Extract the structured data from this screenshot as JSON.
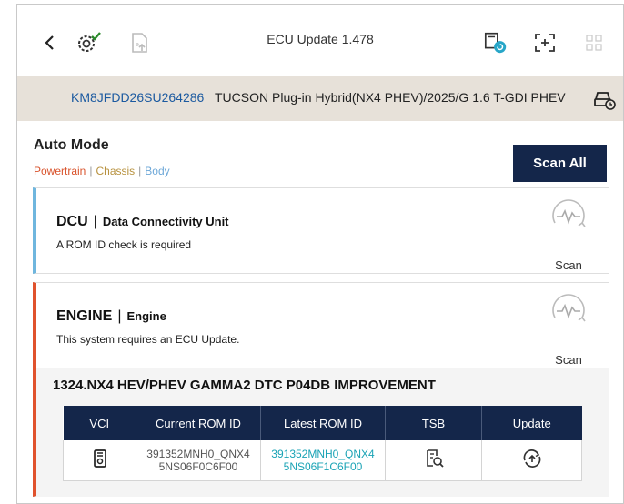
{
  "topbar": {
    "title": "ECU Update 1.478"
  },
  "vehicle": {
    "vin": "KM8JFDD26SU264286",
    "description": "TUCSON Plug-in Hybrid(NX4 PHEV)/2025/G 1.6 T-GDI PHEV"
  },
  "mode": {
    "title": "Auto Mode",
    "categories": [
      "Powertrain",
      "Chassis",
      "Body"
    ],
    "scan_all_label": "Scan All"
  },
  "systems": [
    {
      "code": "DCU",
      "name": "Data Connectivity Unit",
      "message": "A ROM ID check is required",
      "scan_label": "Scan"
    },
    {
      "code": "ENGINE",
      "name": "Engine",
      "message": "This system requires an ECU Update.",
      "scan_label": "Scan",
      "update": {
        "title": "1324.NX4 HEV/PHEV GAMMA2 DTC P04DB IMPROVEMENT",
        "columns": [
          "VCI",
          "Current ROM ID",
          "Latest ROM ID",
          "TSB",
          "Update"
        ],
        "row": {
          "current_line1": "391352MNH0_QNX4",
          "current_line2": "5NS06F0C6F00",
          "latest_line1": "391352MNH0_QNX4",
          "latest_line2": "5NS06F1C6F00"
        }
      }
    }
  ],
  "colors": {
    "navy": "#14264a",
    "powertrain": "#d9532c",
    "chassis": "#b8923f",
    "body": "#6ea8d8",
    "dcu_accent": "#6fb6de",
    "engine_accent": "#e0522d",
    "latest_rom": "#1aa3b5"
  },
  "icons": [
    "back-icon",
    "vci-connected-icon",
    "ecu-upload-icon",
    "ecu-status-icon",
    "screen-capture-icon",
    "grid-menu-icon",
    "vehicle-info-icon",
    "scan-icon",
    "vci-icon",
    "tsb-search-icon",
    "update-icon"
  ]
}
